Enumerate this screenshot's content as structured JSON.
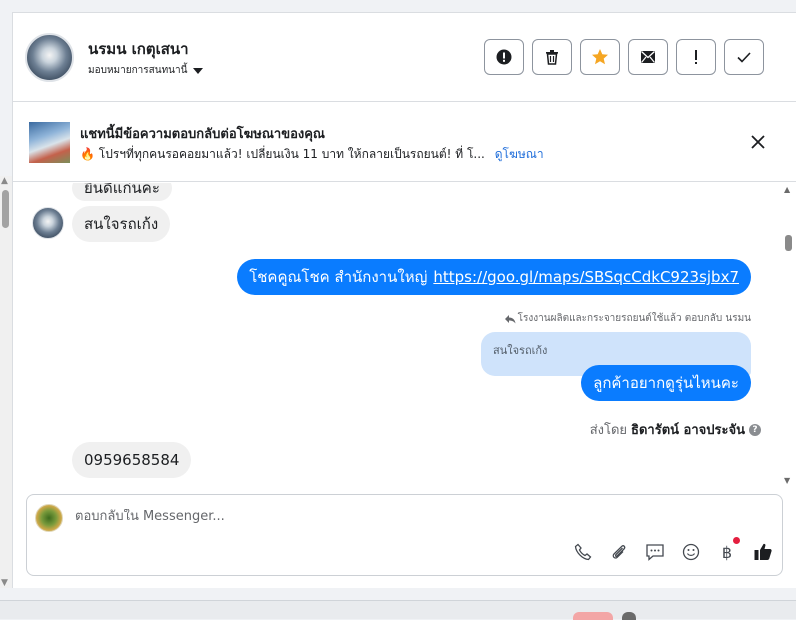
{
  "header": {
    "contact_name": "นรมน เกตุเสนา",
    "assign_label": "มอบหมายการสนทนานี้",
    "actions": [
      {
        "icon": "alert-circle-icon",
        "label": "รายงานสแปม"
      },
      {
        "icon": "trash-icon",
        "label": "ลบ"
      },
      {
        "icon": "star-icon",
        "label": "ติดดาว"
      },
      {
        "icon": "mark-unread-icon",
        "label": "ทำเครื่องหมายยังไม่ได้อ่าน"
      },
      {
        "icon": "follow-up-icon",
        "label": "ติดตาม"
      },
      {
        "icon": "check-icon",
        "label": "ทำเสร็จแล้ว"
      }
    ]
  },
  "ad_banner": {
    "title": "แชทนี้มีข้อความตอบกลับต่อโฆษณาของคุณ",
    "subtitle": "โปรฯที่ทุกคนรอคอยมาแล้ว! เปลี่ยนเงิน 11 บาท ให้กลายเป็นรถยนต์! ที่ โ...",
    "view_ad_link": "ดูโฆษณา"
  },
  "messages": {
    "partial_top": "ยินดีแก่นคะ",
    "in_1": "สนใจรถเก้ง",
    "out_1_text": "โชคคูณโชค สำนักงานใหญ่",
    "out_1_url": "https://goo.gl/maps/SBSqcCdkC923sjbx7",
    "reply_note": "โรงงานผลิตและกระจายรถยนต์ใช้แล้ว ตอบกลับ นรมน",
    "quoted": "สนใจรถเก้ง",
    "out_2": "ลูกค้าอยากดูรุ่นไหนคะ",
    "sent_by_prefix": "ส่งโดย",
    "sent_by_name": "ธิดารัตน์ อาจประจัน",
    "in_2": "0959658584"
  },
  "composer": {
    "placeholder": "ตอบกลับใน Messenger...",
    "icons": [
      "phone-icon",
      "paperclip-icon",
      "saved-reply-icon",
      "emoji-icon",
      "baht-payment-icon",
      "thumbs-up-icon"
    ]
  },
  "colors": {
    "outgoing_bubble": "#0a7cff",
    "incoming_bubble": "#f0f0f0",
    "star": "#f5a623",
    "link": "#216fdb"
  }
}
